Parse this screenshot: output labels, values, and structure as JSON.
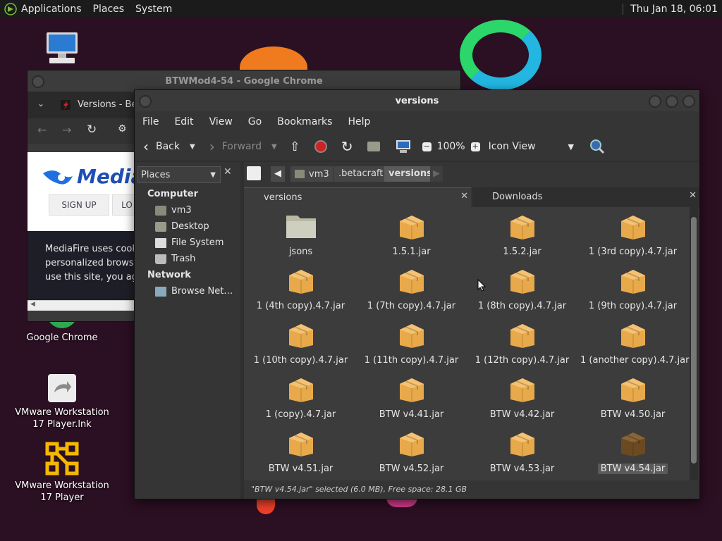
{
  "top_panel": {
    "menus": [
      "Applications",
      "Places",
      "System"
    ],
    "clock": "Thu Jan 18, 06:01"
  },
  "desktop_icons": [
    {
      "label": "",
      "icon": "computer-icon"
    },
    {
      "label": "Google Chrome",
      "icon": "chrome-icon"
    },
    {
      "label": "VMware Workstation 17 Player.lnk",
      "icon": "shortcut-icon"
    },
    {
      "label": "VMware Workstation 17 Player",
      "icon": "vmware-icon"
    }
  ],
  "chrome_window": {
    "title": "BTWMod4-54 - Google Chrome",
    "tab_title": "Versions - Bet",
    "page": {
      "logo": "Media",
      "signup": "SIGN UP",
      "login": "LO",
      "cookie_lines": [
        "MediaFire uses cookie",
        "personalized browsing",
        "use this site, you agre"
      ]
    }
  },
  "file_manager": {
    "title": "versions",
    "menus": [
      "File",
      "Edit",
      "View",
      "Go",
      "Bookmarks",
      "Help"
    ],
    "toolbar": {
      "back": "Back",
      "forward": "Forward",
      "zoom": "100%",
      "view_mode": "Icon View"
    },
    "sidebar": {
      "selector": "Places",
      "sections": [
        {
          "heading": "Computer",
          "items": [
            {
              "label": "vm3",
              "icon": "home-icon"
            },
            {
              "label": "Desktop",
              "icon": "desktop-icon"
            },
            {
              "label": "File System",
              "icon": "drive-icon"
            },
            {
              "label": "Trash",
              "icon": "trash-icon"
            }
          ]
        },
        {
          "heading": "Network",
          "items": [
            {
              "label": "Browse Net…",
              "icon": "network-icon"
            }
          ]
        }
      ]
    },
    "path": [
      "vm3",
      ".betacraft",
      "versions"
    ],
    "tabs": [
      "versions",
      "Downloads"
    ],
    "files": [
      {
        "name": "jsons",
        "type": "folder"
      },
      {
        "name": "1.5.1.jar",
        "type": "jar"
      },
      {
        "name": "1.5.2.jar",
        "type": "jar"
      },
      {
        "name": "1 (3rd copy).4.7.jar",
        "type": "jar"
      },
      {
        "name": "1 (4th copy).4.7.jar",
        "type": "jar"
      },
      {
        "name": "1 (7th copy).4.7.jar",
        "type": "jar"
      },
      {
        "name": "1 (8th copy).4.7.jar",
        "type": "jar"
      },
      {
        "name": "1 (9th copy).4.7.jar",
        "type": "jar"
      },
      {
        "name": "1 (10th copy).4.7.jar",
        "type": "jar"
      },
      {
        "name": "1 (11th copy).4.7.jar",
        "type": "jar"
      },
      {
        "name": "1 (12th copy).4.7.jar",
        "type": "jar"
      },
      {
        "name": "1 (another copy).4.7.jar",
        "type": "jar"
      },
      {
        "name": "1 (copy).4.7.jar",
        "type": "jar"
      },
      {
        "name": "BTW v4.41.jar",
        "type": "jar"
      },
      {
        "name": "BTW v4.42.jar",
        "type": "jar"
      },
      {
        "name": "BTW v4.50.jar",
        "type": "jar"
      },
      {
        "name": "BTW v4.51.jar",
        "type": "jar"
      },
      {
        "name": "BTW v4.52.jar",
        "type": "jar"
      },
      {
        "name": "BTW v4.53.jar",
        "type": "jar"
      },
      {
        "name": "BTW v4.54.jar",
        "type": "jar",
        "selected": true
      }
    ],
    "status": "\"BTW v4.54.jar\" selected (6.0 MB), Free space: 28.1 GB"
  },
  "colors": {
    "desktop_bg": "#2b0f22",
    "panel_bg": "#1b1b1b",
    "window_bg": "#353535",
    "jar_icon": "#e8a94a",
    "selected_jar_icon": "#6b4a22"
  }
}
